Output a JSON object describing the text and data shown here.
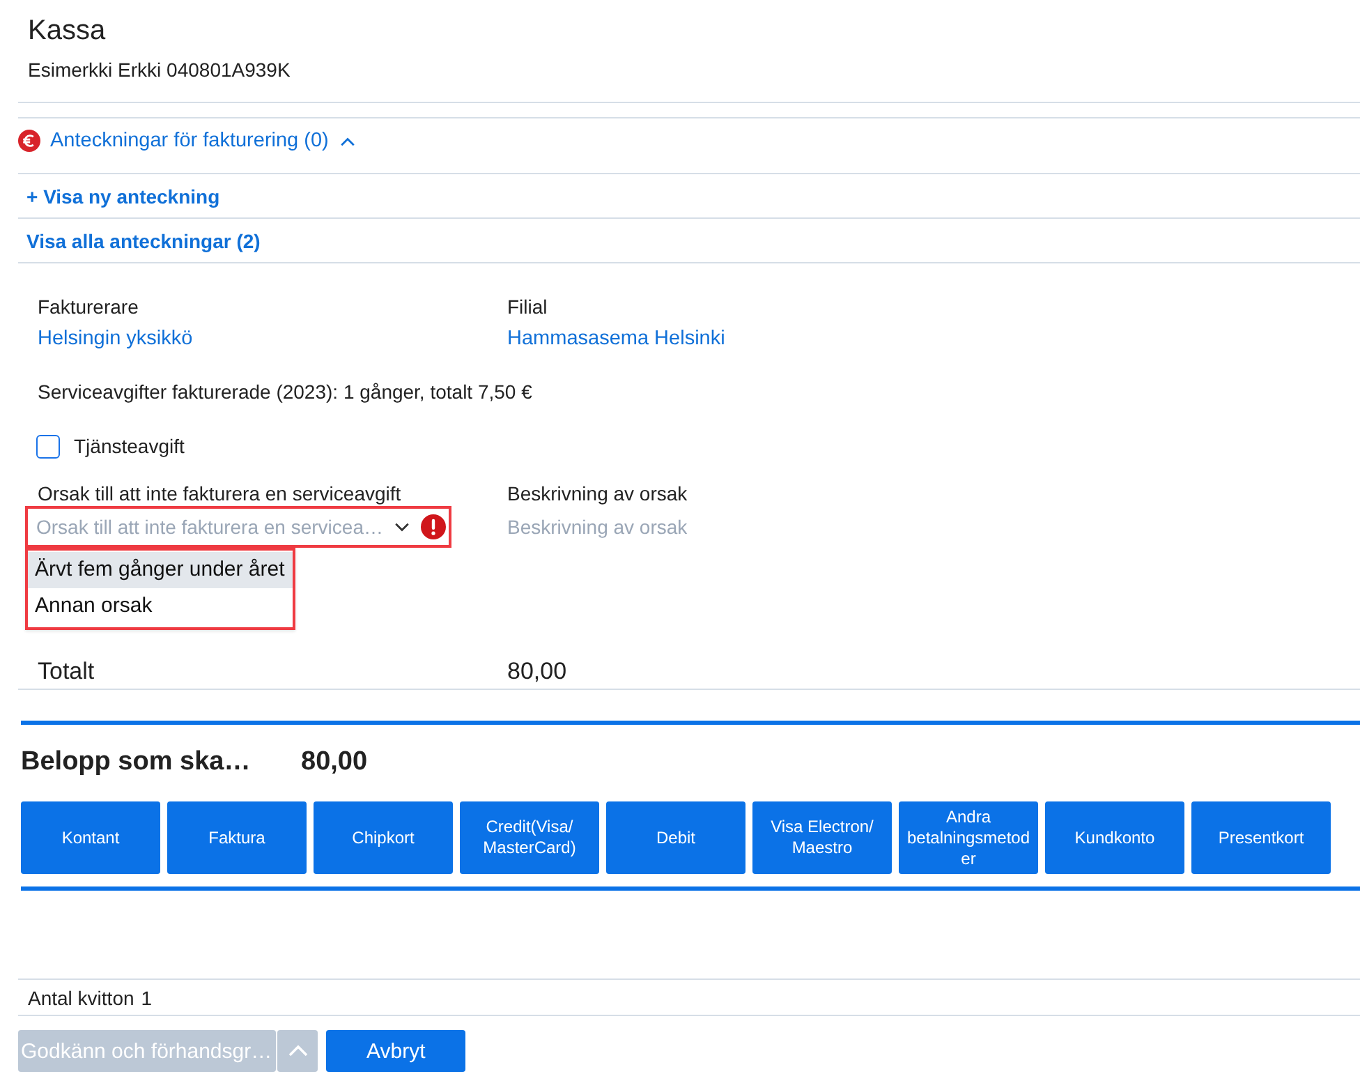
{
  "header": {
    "title": "Kassa",
    "subtitle": "Esimerkki Erkki 040801A939K"
  },
  "notes": {
    "toggle": "Anteckningar för fakturering (0)",
    "expanded": true,
    "links": [
      "+ Visa ny anteckning",
      "Visa alla anteckningar (2)"
    ]
  },
  "billing": {
    "fields": [
      {
        "label": "Fakturerare",
        "value": "Helsingin yksikkö"
      },
      {
        "label": "Filial",
        "value": "Hammasasema Helsinki"
      }
    ],
    "service_summary": "Serviceavgifter fakturerade (2023): 1 gånger, totalt 7,50 €",
    "service_fee": {
      "label": "Tjänsteavgift",
      "checked": false
    },
    "reason": {
      "label": "Orsak till att inte fakturera en serviceavgift",
      "placeholder": "Orsak till att inte fakturera en servicea…",
      "error": true,
      "highlighted": true,
      "expanded": true,
      "options": [
        {
          "label": "Ärvt fem gånger under året",
          "selected": true
        },
        {
          "label": "Annan orsak",
          "selected": false
        }
      ]
    },
    "description": {
      "label": "Beskrivning av orsak",
      "placeholder": "Beskrivning av orsak"
    },
    "total": {
      "label": "Totalt",
      "value": "80,00"
    }
  },
  "payment": {
    "label": "Belopp som ska…",
    "amount": "80,00",
    "methods": [
      "Kontant",
      "Faktura",
      "Chipkort",
      "Credit(Visa/ MasterCard)",
      "Debit",
      "Visa Electron/ Maestro",
      "Andra betalningsmetoder",
      "Kundkonto",
      "Presentkort"
    ]
  },
  "receipts": {
    "label": "Antal kvitton",
    "value": "1"
  },
  "actions": [
    {
      "label": "Godkänn och förhandsgr…",
      "kind": "split",
      "disabled": true
    },
    {
      "label": "Avbryt",
      "kind": "button",
      "disabled": false
    }
  ]
}
